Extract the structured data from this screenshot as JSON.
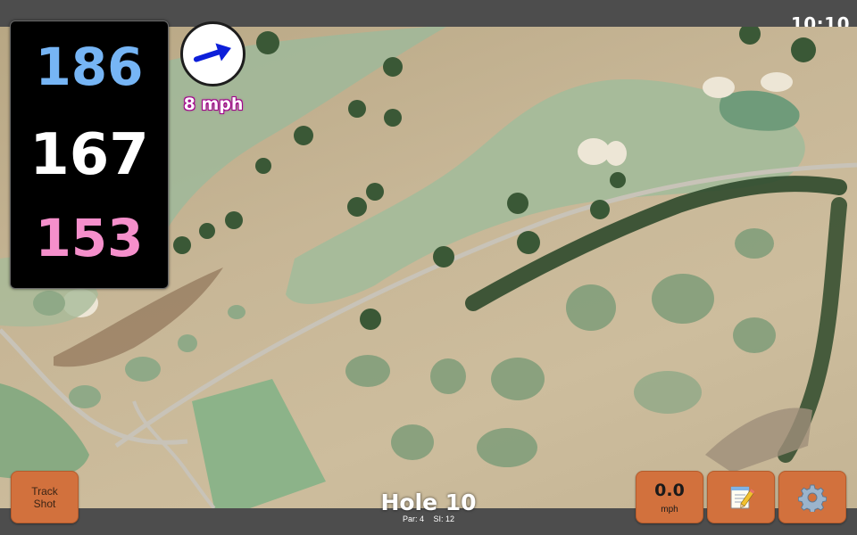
{
  "status_bar": {
    "clock": "10:10"
  },
  "distances": {
    "back": "186",
    "center": "167",
    "front": "153",
    "colors": {
      "back": "#76b5f5",
      "center": "#ffffff",
      "front": "#f58fcb"
    }
  },
  "wind": {
    "speed_label": "8 mph",
    "direction_icon": "arrow-up-right-icon"
  },
  "buttons": {
    "track_shot_line1": "Track",
    "track_shot_line2": "Shot",
    "wind_value": "0.0",
    "wind_unit": "mph",
    "notes_icon": "notepad-icon",
    "settings_icon": "gear-icon"
  },
  "hole": {
    "title": "Hole 10",
    "par_label": "Par: 4",
    "si_label": "SI: 12"
  },
  "colors": {
    "button": "#d2713d",
    "bar": "#4d4d4d"
  }
}
